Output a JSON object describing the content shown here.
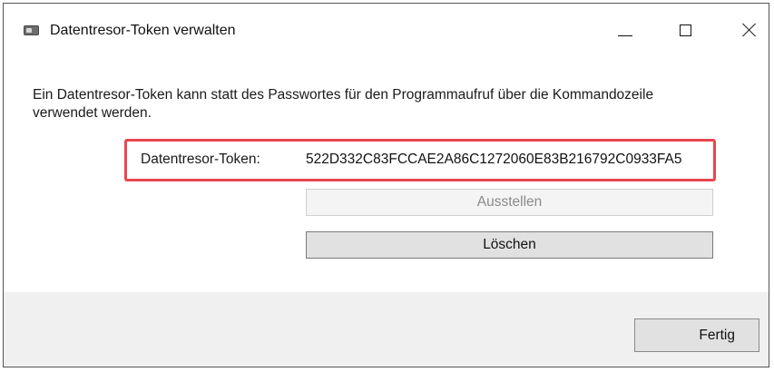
{
  "window": {
    "title": "Datentresor-Token verwalten",
    "icon": "dialog-window-icon"
  },
  "controls": {
    "minimize_icon": "minimize-icon",
    "maximize_icon": "maximize-icon",
    "close_icon": "close-icon"
  },
  "content": {
    "description": "Ein Datentresor-Token kann statt des Passwortes für den Programmaufruf über die Kommandozeile verwendet werden.",
    "token_label": "Datentresor-Token:",
    "token_value": "522D332C83FCCAE2A86C1272060E83B216792C0933FA5",
    "highlight_color": "#e8474f"
  },
  "buttons": {
    "issue_label": "Ausstellen",
    "issue_enabled": false,
    "delete_label": "Löschen",
    "done_label": "Fertig"
  }
}
